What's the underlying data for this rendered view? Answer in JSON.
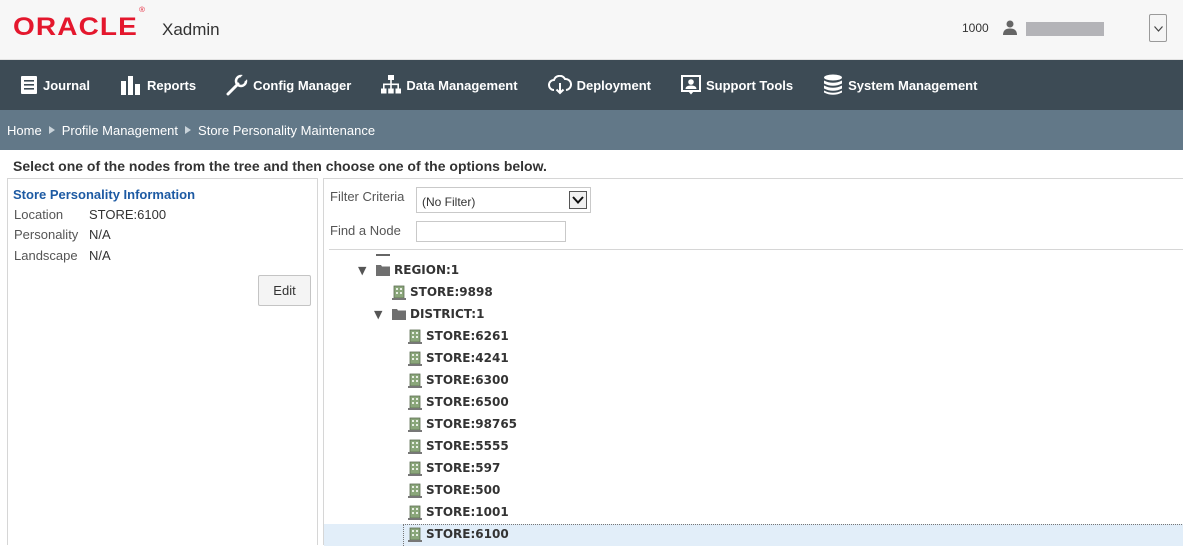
{
  "header": {
    "logo_text": "ORACLE",
    "app_name": "Xadmin",
    "user_id": "1000",
    "user_icon": "user-icon",
    "menu_icon": "chevron-down-icon"
  },
  "nav": [
    {
      "label": "Journal",
      "icon": "journal-icon"
    },
    {
      "label": "Reports",
      "icon": "bar-chart-icon"
    },
    {
      "label": "Config Manager",
      "icon": "wrench-icon"
    },
    {
      "label": "Data Management",
      "icon": "hierarchy-icon"
    },
    {
      "label": "Deployment",
      "icon": "cloud-download-icon"
    },
    {
      "label": "Support Tools",
      "icon": "support-icon"
    },
    {
      "label": "System Management",
      "icon": "database-icon"
    }
  ],
  "breadcrumb": [
    "Home",
    "Profile Management",
    "Store Personality Maintenance"
  ],
  "instruction": "Select one of the nodes from the tree and then choose one of the options below.",
  "info": {
    "title": "Store Personality Information",
    "rows": [
      {
        "label": "Location",
        "value": "STORE:6100"
      },
      {
        "label": "Personality",
        "value": "N/A"
      },
      {
        "label": "Landscape",
        "value": "N/A"
      }
    ],
    "edit_label": "Edit"
  },
  "filter": {
    "label": "Filter Criteria",
    "selected": "(No Filter)"
  },
  "find": {
    "label": "Find a Node",
    "value": ""
  },
  "tree": [
    {
      "label": "REGION:1",
      "type": "folder",
      "expanded": true,
      "depth": 0
    },
    {
      "label": "STORE:9898",
      "type": "store",
      "depth": 1
    },
    {
      "label": "DISTRICT:1",
      "type": "folder",
      "expanded": true,
      "depth": 1
    },
    {
      "label": "STORE:6261",
      "type": "store",
      "depth": 2
    },
    {
      "label": "STORE:4241",
      "type": "store",
      "depth": 2
    },
    {
      "label": "STORE:6300",
      "type": "store",
      "depth": 2
    },
    {
      "label": "STORE:6500",
      "type": "store",
      "depth": 2
    },
    {
      "label": "STORE:98765",
      "type": "store",
      "depth": 2
    },
    {
      "label": "STORE:5555",
      "type": "store",
      "depth": 2
    },
    {
      "label": "STORE:597",
      "type": "store",
      "depth": 2
    },
    {
      "label": "STORE:500",
      "type": "store",
      "depth": 2
    },
    {
      "label": "STORE:1001",
      "type": "store",
      "depth": 2
    },
    {
      "label": "STORE:6100",
      "type": "store",
      "depth": 2,
      "selected": true
    }
  ],
  "colors": {
    "brand_red": "#e4172d",
    "nav_bg": "#3d4b55",
    "breadcrumb_bg": "#627888",
    "link_blue": "#1d5aa3",
    "selected_bg": "#e2eef9"
  }
}
